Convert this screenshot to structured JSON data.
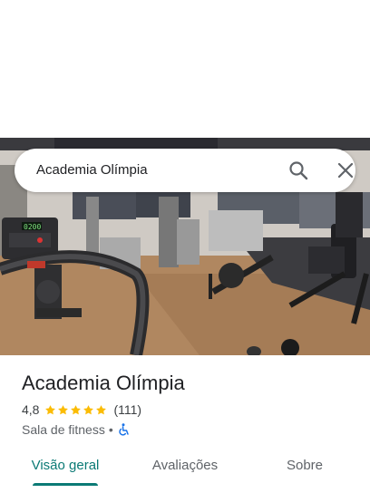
{
  "search": {
    "query": "Academia Olímpia",
    "search_icon": "search-icon",
    "close_icon": "close-icon"
  },
  "photo": {
    "treadmill_display": "0200",
    "description_icon": "gym-photo"
  },
  "place": {
    "name": "Academia Olímpia",
    "rating": "4,8",
    "stars": 5,
    "review_count": "(111)",
    "category": "Sala de fitness",
    "separator": "•",
    "accessibility_icon": "wheelchair-icon"
  },
  "tabs": [
    {
      "label": "Visão geral",
      "active": true
    },
    {
      "label": "Avaliações",
      "active": false
    },
    {
      "label": "Sobre",
      "active": false
    }
  ],
  "colors": {
    "accent": "#0b7a75",
    "star": "#fbbc04",
    "accessibility": "#1a73e8"
  }
}
